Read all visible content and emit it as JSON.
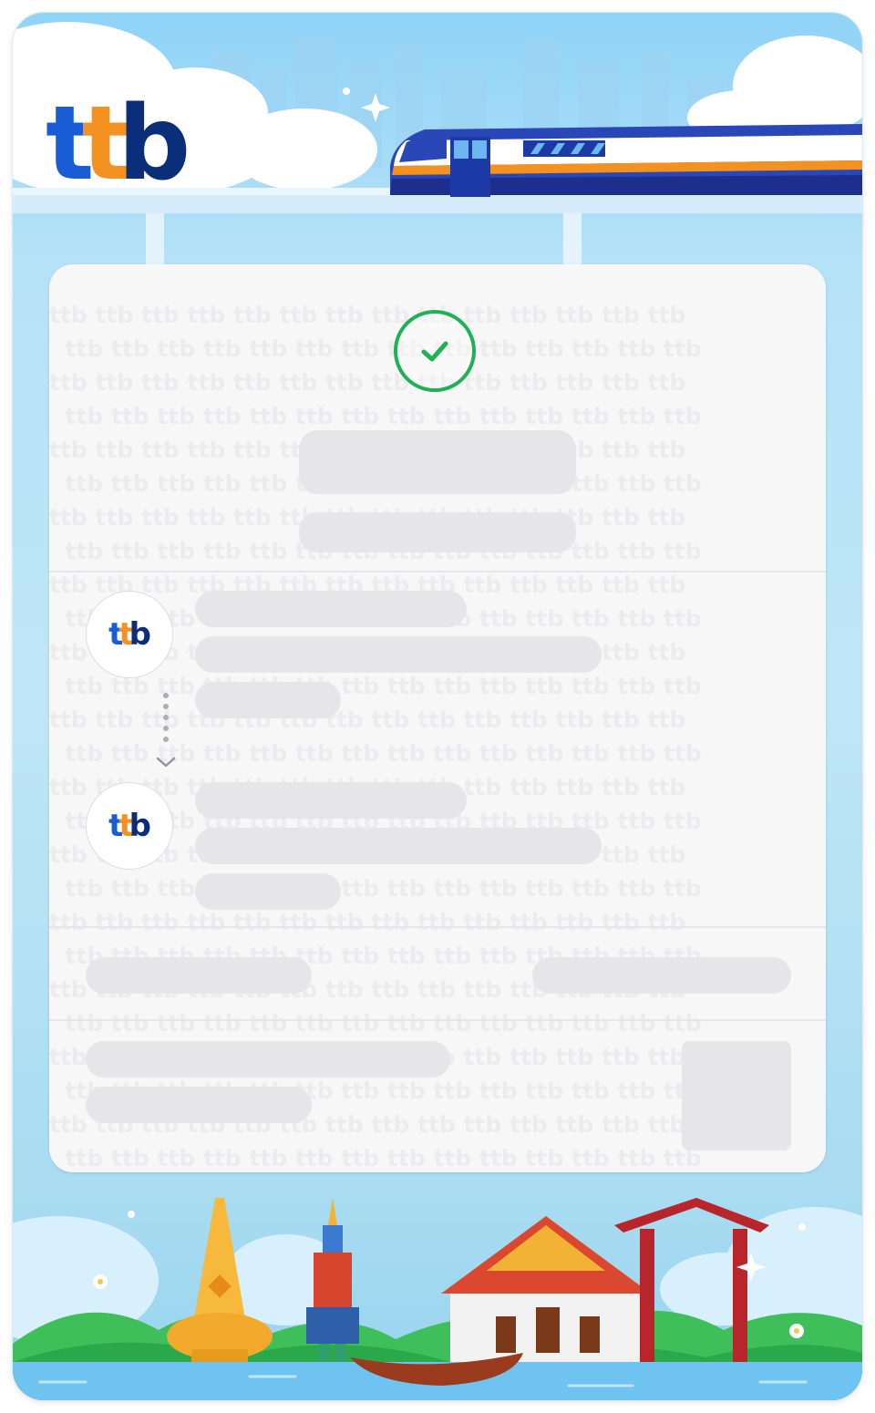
{
  "brand": {
    "logo_parts": [
      "t",
      "t",
      "b"
    ],
    "colors": {
      "primary_blue": "#1a5cd6",
      "orange": "#f39221",
      "navy": "#0b2e7a",
      "success_green": "#1fb153"
    }
  },
  "status": {
    "icon": "check-circle-icon"
  },
  "transfer": {
    "from_avatar": [
      "t",
      "t",
      "b"
    ],
    "to_avatar": [
      "t",
      "t",
      "b"
    ],
    "connector_icon": "chevron-down-icon"
  },
  "illustrations": {
    "top": [
      "cloud",
      "skytrain",
      "city-skyline"
    ],
    "bottom": [
      "golden-pagoda",
      "giant-guardian",
      "thai-temple",
      "giant-swing",
      "long-tail-boat"
    ]
  }
}
